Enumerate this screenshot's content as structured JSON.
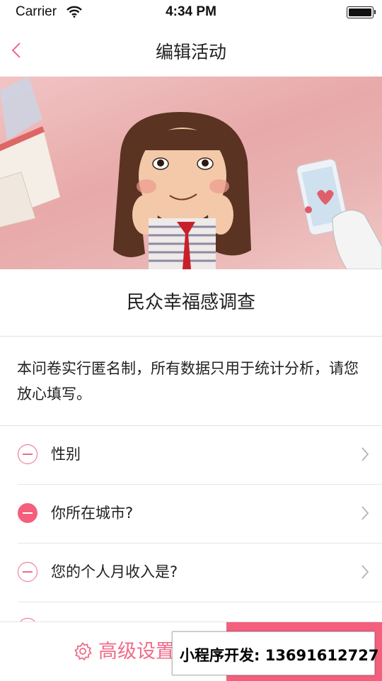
{
  "status_bar": {
    "carrier": "Carrier",
    "time": "4:34 PM"
  },
  "nav": {
    "title": "编辑活动"
  },
  "survey": {
    "title": "民众幸福感调查",
    "description": "本问卷实行匿名制，所有数据只用于统计分析，请您放心填写。"
  },
  "questions": [
    {
      "label": "性别",
      "icon_state": "outline"
    },
    {
      "label": "你所在城市?",
      "icon_state": "filled"
    },
    {
      "label": "您的个人月收入是?",
      "icon_state": "outline"
    }
  ],
  "bottom_bar": {
    "advanced_label": "高级设置"
  },
  "contact": {
    "text": "小程序开发: 13691612727"
  },
  "colors": {
    "accent": "#f06b88",
    "accent_solid": "#f55f7e",
    "divider": "#e2e2e2"
  }
}
